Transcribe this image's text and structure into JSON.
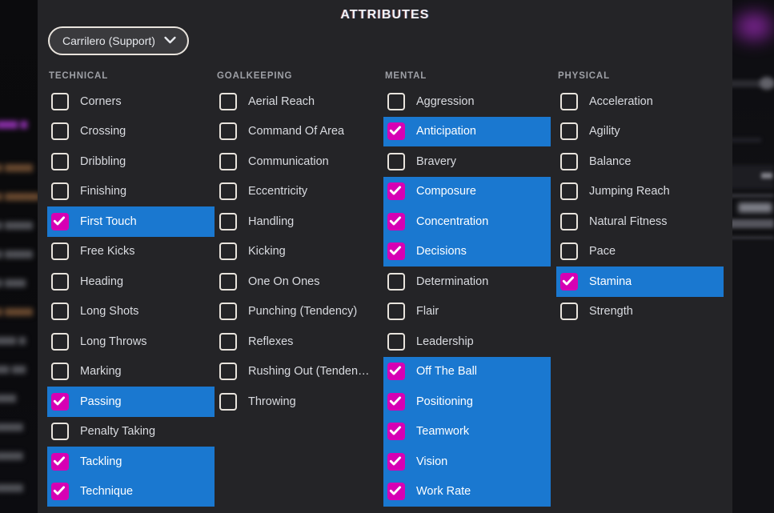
{
  "window": {
    "title": "ATTRIBUTES",
    "panel_bg": "#242427",
    "accent_selected_row": "#1a78d0",
    "accent_checkbox": "#d600b4"
  },
  "role_dropdown": {
    "name": "role-dropdown",
    "value": "Carrilero (Support)",
    "icon": "chevron-down-icon"
  },
  "columns": [
    {
      "header": "TECHNICAL",
      "items": [
        {
          "label": "Corners",
          "checked": false
        },
        {
          "label": "Crossing",
          "checked": false
        },
        {
          "label": "Dribbling",
          "checked": false
        },
        {
          "label": "Finishing",
          "checked": false
        },
        {
          "label": "First Touch",
          "checked": true
        },
        {
          "label": "Free Kicks",
          "checked": false
        },
        {
          "label": "Heading",
          "checked": false
        },
        {
          "label": "Long Shots",
          "checked": false
        },
        {
          "label": "Long Throws",
          "checked": false
        },
        {
          "label": "Marking",
          "checked": false
        },
        {
          "label": "Passing",
          "checked": true
        },
        {
          "label": "Penalty Taking",
          "checked": false
        },
        {
          "label": "Tackling",
          "checked": true
        },
        {
          "label": "Technique",
          "checked": true
        }
      ]
    },
    {
      "header": "GOALKEEPING",
      "items": [
        {
          "label": "Aerial Reach",
          "checked": false
        },
        {
          "label": "Command Of Area",
          "checked": false
        },
        {
          "label": "Communication",
          "checked": false
        },
        {
          "label": "Eccentricity",
          "checked": false
        },
        {
          "label": "Handling",
          "checked": false
        },
        {
          "label": "Kicking",
          "checked": false
        },
        {
          "label": "One On Ones",
          "checked": false
        },
        {
          "label": "Punching (Tendency)",
          "checked": false
        },
        {
          "label": "Reflexes",
          "checked": false
        },
        {
          "label": "Rushing Out (Tenden…",
          "checked": false
        },
        {
          "label": "Throwing",
          "checked": false
        }
      ]
    },
    {
      "header": "MENTAL",
      "items": [
        {
          "label": "Aggression",
          "checked": false
        },
        {
          "label": "Anticipation",
          "checked": true
        },
        {
          "label": "Bravery",
          "checked": false
        },
        {
          "label": "Composure",
          "checked": true
        },
        {
          "label": "Concentration",
          "checked": true
        },
        {
          "label": "Decisions",
          "checked": true
        },
        {
          "label": "Determination",
          "checked": false
        },
        {
          "label": "Flair",
          "checked": false
        },
        {
          "label": "Leadership",
          "checked": false
        },
        {
          "label": "Off The Ball",
          "checked": true
        },
        {
          "label": "Positioning",
          "checked": true
        },
        {
          "label": "Teamwork",
          "checked": true
        },
        {
          "label": "Vision",
          "checked": true
        },
        {
          "label": "Work Rate",
          "checked": true
        }
      ]
    },
    {
      "header": "PHYSICAL",
      "items": [
        {
          "label": "Acceleration",
          "checked": false
        },
        {
          "label": "Agility",
          "checked": false
        },
        {
          "label": "Balance",
          "checked": false
        },
        {
          "label": "Jumping Reach",
          "checked": false
        },
        {
          "label": "Natural Fitness",
          "checked": false
        },
        {
          "label": "Pace",
          "checked": false
        },
        {
          "label": "Stamina",
          "checked": true
        },
        {
          "label": "Strength",
          "checked": false
        }
      ]
    }
  ]
}
